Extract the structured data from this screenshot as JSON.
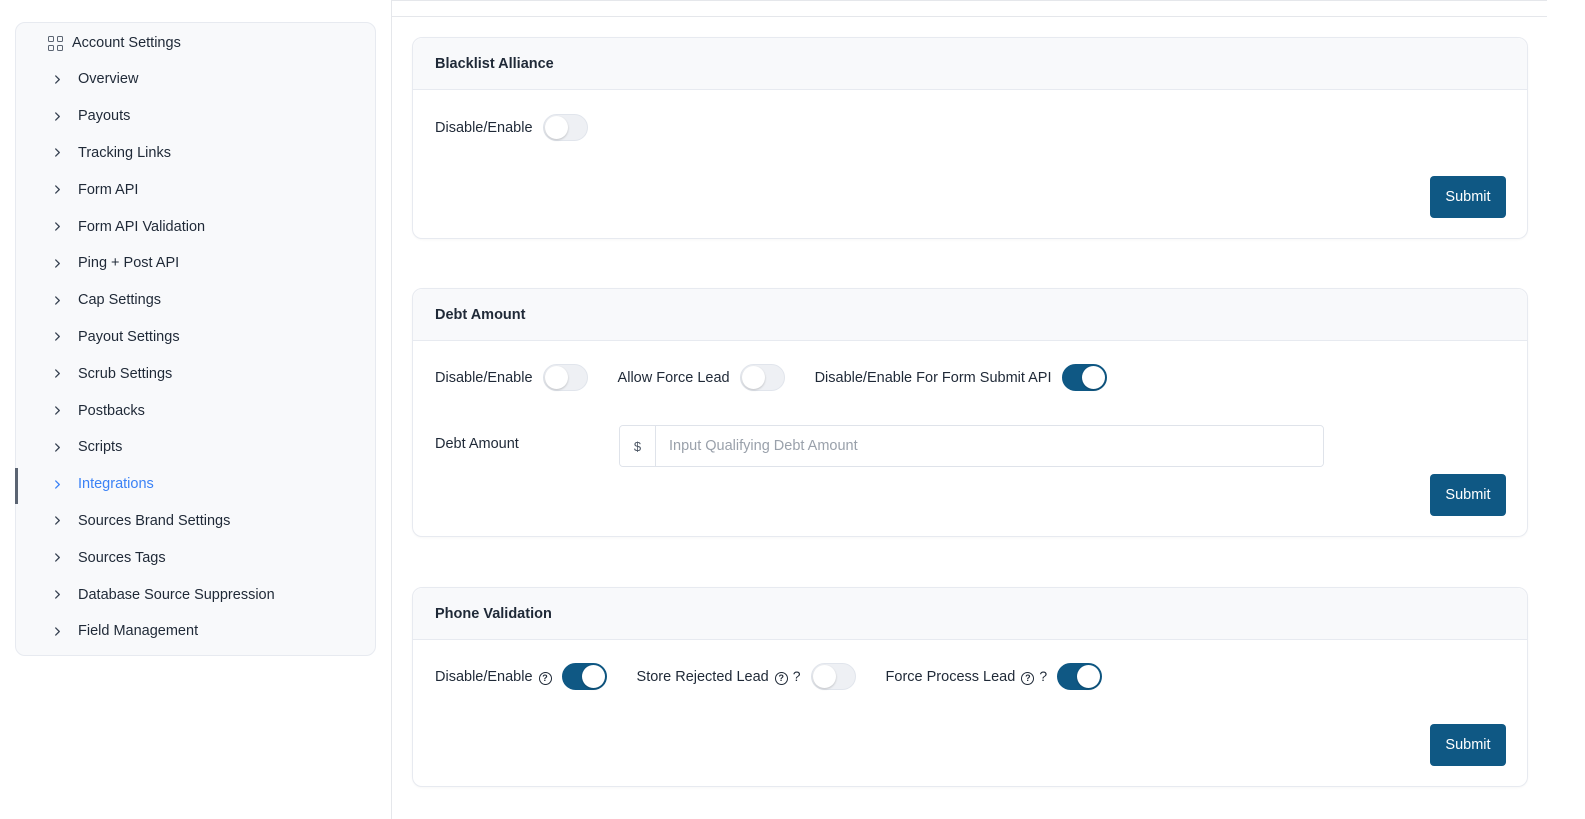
{
  "sidebar": {
    "title": "Account Settings",
    "title_icon": "grid-icon",
    "items": [
      {
        "label": "Overview",
        "active": false
      },
      {
        "label": "Payouts",
        "active": false
      },
      {
        "label": "Tracking Links",
        "active": false
      },
      {
        "label": "Form API",
        "active": false
      },
      {
        "label": "Form API Validation",
        "active": false
      },
      {
        "label": "Ping + Post API",
        "active": false
      },
      {
        "label": "Cap Settings",
        "active": false
      },
      {
        "label": "Payout Settings",
        "active": false
      },
      {
        "label": "Scrub Settings",
        "active": false
      },
      {
        "label": "Postbacks",
        "active": false
      },
      {
        "label": "Scripts",
        "active": false
      },
      {
        "label": "Integrations",
        "active": true
      },
      {
        "label": "Sources Brand Settings",
        "active": false
      },
      {
        "label": "Sources Tags",
        "active": false
      },
      {
        "label": "Database Source Suppression",
        "active": false
      },
      {
        "label": "Field Management",
        "active": false
      }
    ]
  },
  "colors": {
    "primary": "#0f5884",
    "active_link": "#3b82f6",
    "card_header_bg": "#f8f9fb"
  },
  "cards": {
    "blacklist": {
      "title": "Blacklist Alliance",
      "toggle_label": "Disable/Enable",
      "toggle_on": false,
      "submit_label": "Submit"
    },
    "debt": {
      "title": "Debt Amount",
      "toggle1_label": "Disable/Enable",
      "toggle1_on": false,
      "toggle2_label": "Allow Force Lead",
      "toggle2_on": false,
      "toggle3_label": "Disable/Enable For Form Submit API",
      "toggle3_on": true,
      "field_label": "Debt Amount",
      "field_prefix": "$",
      "field_placeholder": "Input Qualifying Debt Amount",
      "field_value": "",
      "submit_label": "Submit"
    },
    "phone": {
      "title": "Phone Validation",
      "toggle1_label": "Disable/Enable",
      "toggle1_help": "?",
      "toggle1_on": true,
      "toggle2_label": "Store Rejected Lead",
      "toggle2_help": "?",
      "toggle2_suffix": "?",
      "toggle2_on": false,
      "toggle3_label": "Force Process Lead",
      "toggle3_help": "?",
      "toggle3_suffix": "?",
      "toggle3_on": true,
      "submit_label": "Submit"
    }
  }
}
